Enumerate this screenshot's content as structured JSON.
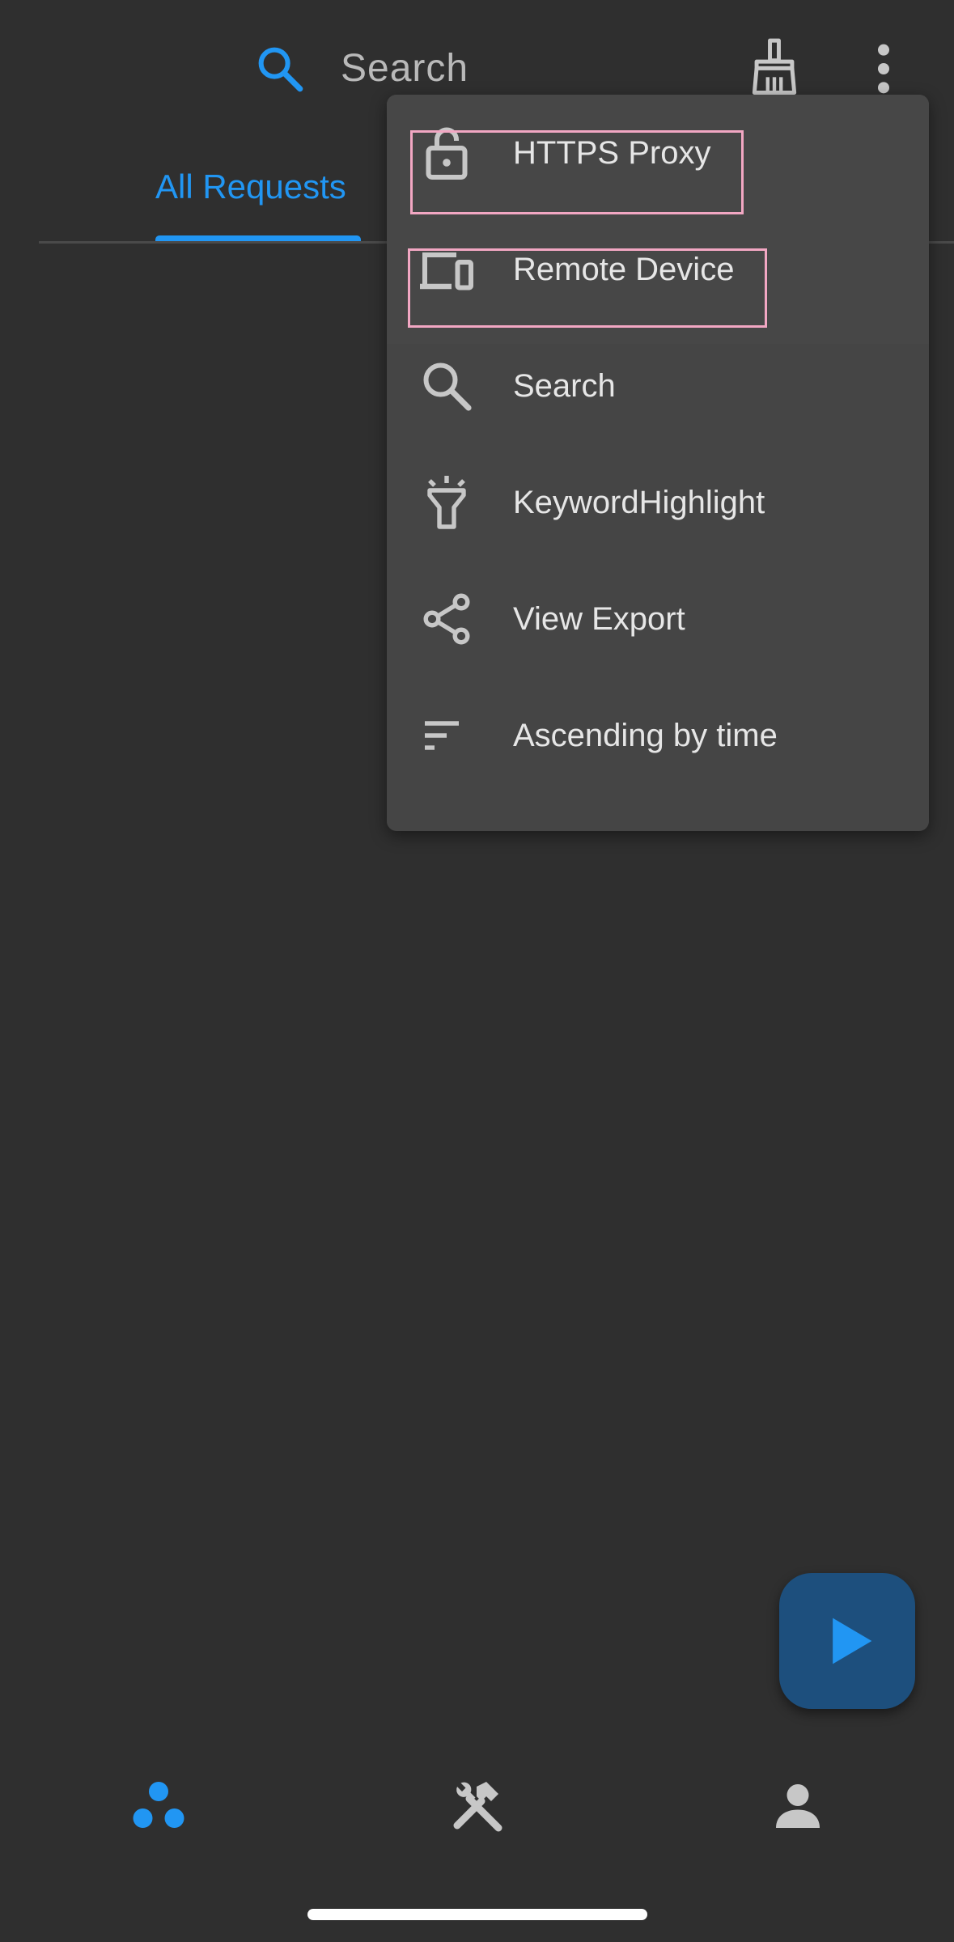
{
  "colors": {
    "background": "#2f2f2f",
    "accent": "#2196f3",
    "menu_background": "#454545",
    "menu_text": "#e6e6e6",
    "icon_gray": "#c7c7c7",
    "highlight_border": "#f2a7c3",
    "fab_background": "#1d4f7d"
  },
  "topbar": {
    "search_icon": "search-icon",
    "search_label": "Search",
    "clean_icon": "broom-icon",
    "more_icon": "more-vert-icon"
  },
  "tabs": [
    {
      "label": "All Requests",
      "selected": true
    }
  ],
  "menu": {
    "items": [
      {
        "label": "HTTPS Proxy",
        "icon": "lock-open-icon",
        "highlighted": true
      },
      {
        "label": "Remote Device",
        "icon": "devices-icon",
        "highlighted": true
      },
      {
        "label": "Search",
        "icon": "search-icon",
        "highlighted": false
      },
      {
        "label": "KeywordHighlight",
        "icon": "flashlight-icon",
        "highlighted": false
      },
      {
        "label": "View Export",
        "icon": "share-icon",
        "highlighted": false
      },
      {
        "label": "Ascending by time",
        "icon": "sort-icon",
        "highlighted": false
      }
    ]
  },
  "fab": {
    "icon": "play-icon"
  },
  "bottom_nav": [
    {
      "icon": "bubbles-icon",
      "active": true
    },
    {
      "icon": "tools-icon",
      "active": false
    },
    {
      "icon": "person-icon",
      "active": false
    }
  ]
}
